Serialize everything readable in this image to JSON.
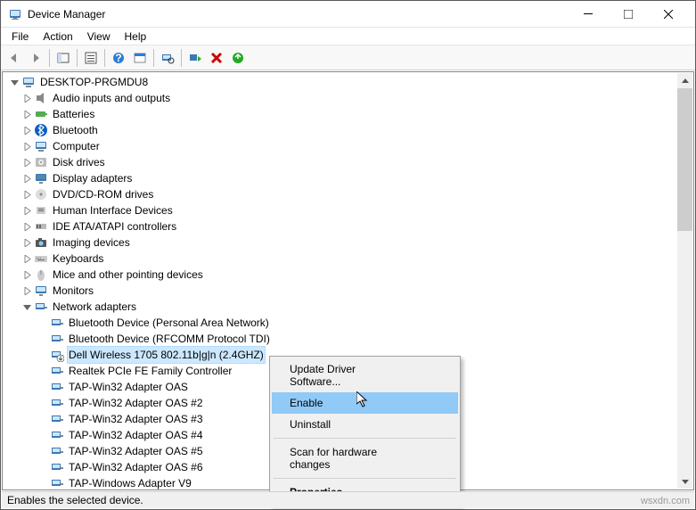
{
  "window": {
    "title": "Device Manager"
  },
  "menubar": {
    "file": "File",
    "action": "Action",
    "view": "View",
    "help": "Help"
  },
  "tree": {
    "root": "DESKTOP-PRGMDU8",
    "categories": [
      {
        "label": "Audio inputs and outputs",
        "icon": "audio"
      },
      {
        "label": "Batteries",
        "icon": "battery"
      },
      {
        "label": "Bluetooth",
        "icon": "bluetooth"
      },
      {
        "label": "Computer",
        "icon": "computer"
      },
      {
        "label": "Disk drives",
        "icon": "disk"
      },
      {
        "label": "Display adapters",
        "icon": "display"
      },
      {
        "label": "DVD/CD-ROM drives",
        "icon": "dvd"
      },
      {
        "label": "Human Interface Devices",
        "icon": "hid"
      },
      {
        "label": "IDE ATA/ATAPI controllers",
        "icon": "ide"
      },
      {
        "label": "Imaging devices",
        "icon": "imaging"
      },
      {
        "label": "Keyboards",
        "icon": "keyboard"
      },
      {
        "label": "Mice and other pointing devices",
        "icon": "mouse"
      },
      {
        "label": "Monitors",
        "icon": "monitor"
      }
    ],
    "network_category": "Network adapters",
    "network_devices": [
      {
        "label": "Bluetooth Device (Personal Area Network)",
        "selected": false,
        "disabled": false
      },
      {
        "label": "Bluetooth Device (RFCOMM Protocol TDI)",
        "selected": false,
        "disabled": false
      },
      {
        "label": "Dell Wireless 1705 802.11b|g|n (2.4GHZ)",
        "selected": true,
        "disabled": true
      },
      {
        "label": "Realtek PCIe FE Family Controller",
        "selected": false,
        "disabled": false
      },
      {
        "label": "TAP-Win32 Adapter OAS",
        "selected": false,
        "disabled": false
      },
      {
        "label": "TAP-Win32 Adapter OAS #2",
        "selected": false,
        "disabled": false
      },
      {
        "label": "TAP-Win32 Adapter OAS #3",
        "selected": false,
        "disabled": false
      },
      {
        "label": "TAP-Win32 Adapter OAS #4",
        "selected": false,
        "disabled": false
      },
      {
        "label": "TAP-Win32 Adapter OAS #5",
        "selected": false,
        "disabled": false
      },
      {
        "label": "TAP-Win32 Adapter OAS #6",
        "selected": false,
        "disabled": false
      },
      {
        "label": "TAP-Windows Adapter V9",
        "selected": false,
        "disabled": false
      }
    ]
  },
  "context_menu": {
    "update": "Update Driver Software...",
    "enable": "Enable",
    "uninstall": "Uninstall",
    "scan": "Scan for hardware changes",
    "properties": "Properties"
  },
  "statusbar": {
    "text": "Enables the selected device."
  },
  "watermark": "wsxdn.com"
}
